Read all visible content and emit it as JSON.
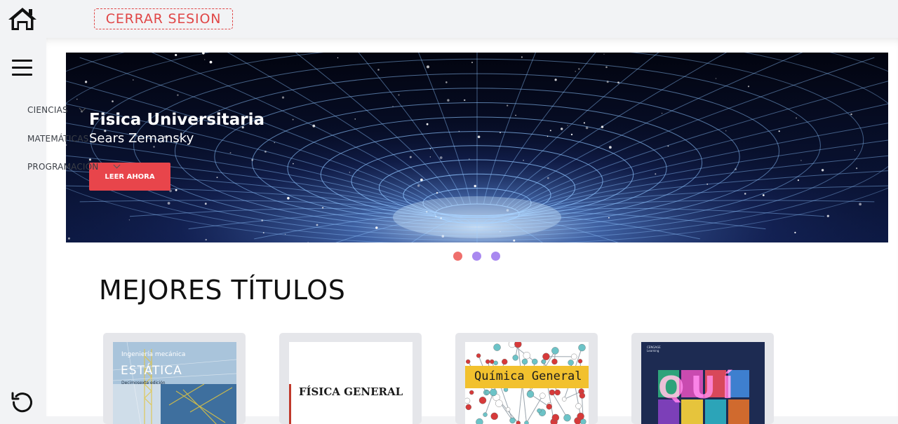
{
  "header": {
    "home_icon": "home-icon",
    "logout_label": "CERRAR SESION"
  },
  "sidebar": {
    "menu_icon": "hamburger-icon",
    "items": [
      {
        "label": "CIENCIAS"
      },
      {
        "label": "MATEMÁTICAS"
      },
      {
        "label": "PROGRAMACIÓN"
      }
    ],
    "reload_icon": "reload-icon"
  },
  "banner": {
    "title": "Fisica Universitaria",
    "subtitle": "Sears Zemansky",
    "button_label": "LEER AHORA"
  },
  "carousel": {
    "active_index": 0,
    "active_color": "#ef6f6c",
    "inactive_color": "#a989f0"
  },
  "section": {
    "title": "MEJORES TÍTULOS"
  },
  "books": [
    {
      "series": "Ingeniería mecánica",
      "title": "ESTÁTICA",
      "edition": "Decimosexta edición"
    },
    {
      "title": "FÍSICA GENERAL"
    },
    {
      "title": "Química General"
    },
    {
      "publisher": "CENGAGE Learning",
      "title": "QUÍ"
    }
  ],
  "colors": {
    "accent": "#e8454b",
    "sidebar_bg": "#f2f3f5"
  }
}
